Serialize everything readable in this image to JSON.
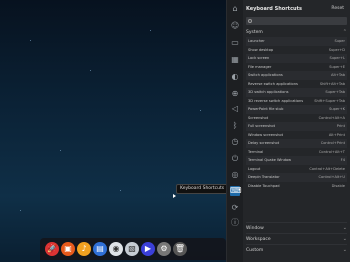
{
  "tooltip": "Keyboard Shortcuts",
  "panel": {
    "title": "Keyboard Shortcuts",
    "reset": "Reset",
    "search_placeholder": "",
    "system_label": "System",
    "shortcuts": [
      {
        "name": "Launcher",
        "key": "Super"
      },
      {
        "name": "Show desktop",
        "key": "Super+D"
      },
      {
        "name": "Lock screen",
        "key": "Super+L"
      },
      {
        "name": "File manager",
        "key": "Super+E"
      },
      {
        "name": "Switch applications",
        "key": "Alt+Tab"
      },
      {
        "name": "Reverse switch applications",
        "key": "Shift+Alt+Tab"
      },
      {
        "name": "3D switch applications",
        "key": "Super+Tab"
      },
      {
        "name": "3D reverse switch applications",
        "key": "Shift+Super+Tab"
      },
      {
        "name": "PowerPoint file stub",
        "key": "Super+K"
      },
      {
        "name": "Screenshot",
        "key": "Control+Alt+A"
      },
      {
        "name": "Full screenshot",
        "key": "Print"
      },
      {
        "name": "Window screenshot",
        "key": "Alt+Print"
      },
      {
        "name": "Delay screenshot",
        "key": "Control+Print"
      },
      {
        "name": "Terminal",
        "key": "Control+Alt+T"
      },
      {
        "name": "Terminal Quake Window",
        "key": "F4"
      },
      {
        "name": "Logout",
        "key": "Control+Alt+Delete"
      },
      {
        "name": "Deepin Translator",
        "key": "Control+Alt+U"
      },
      {
        "name": "Disable Touchpad",
        "key": "Disable"
      }
    ],
    "sections": [
      "Window",
      "Workspace",
      "Custom"
    ]
  },
  "dock": {
    "icons": [
      "launcher-icon",
      "app-store-icon",
      "music-icon",
      "files-icon",
      "chrome-icon",
      "image-viewer-icon",
      "video-icon",
      "settings-icon",
      "trash-icon"
    ]
  },
  "colors": {
    "panel_bg": "#242629",
    "accent": "#1e6aa8"
  }
}
